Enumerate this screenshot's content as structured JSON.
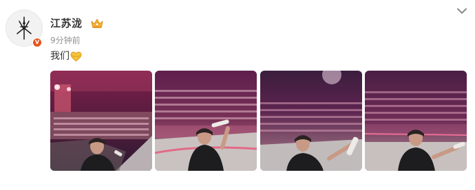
{
  "post": {
    "username": "江苏泷",
    "timestamp": "9分钟前",
    "text": "我们",
    "verified_badge": "V",
    "icons": {
      "avatar": "avatar-logo",
      "vip": "crown-vip-icon",
      "menu": "chevron-down-icon",
      "emoji": "yellow-heart-hands-emoji"
    },
    "photos": [
      {
        "name": "concert-selfie-1"
      },
      {
        "name": "concert-selfie-2"
      },
      {
        "name": "concert-selfie-3"
      },
      {
        "name": "concert-selfie-4"
      }
    ],
    "colors": {
      "name": "#333333",
      "meta": "#939393",
      "verified": "#e8541e",
      "vip": "#f5a623"
    }
  }
}
